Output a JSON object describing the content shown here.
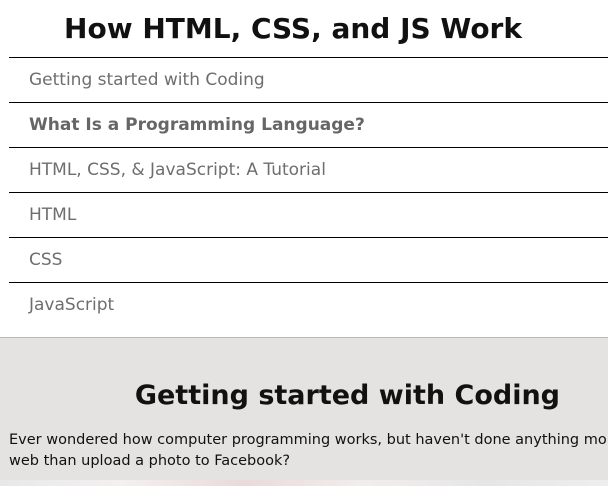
{
  "header": {
    "title": "How HTML, CSS, and JS Work"
  },
  "nav": {
    "items": [
      {
        "label": "Getting started with Coding",
        "bold": false
      },
      {
        "label": "What Is a Programming Language?",
        "bold": true
      },
      {
        "label": "HTML, CSS, & JavaScript: A Tutorial",
        "bold": false
      },
      {
        "label": "HTML",
        "bold": false
      },
      {
        "label": "CSS",
        "bold": false
      },
      {
        "label": "JavaScript",
        "bold": false
      }
    ]
  },
  "main": {
    "section_title": "Getting started with Coding",
    "intro": "Ever wondered how computer programming works, but haven't done anything more web than upload a photo to Facebook?"
  },
  "colors": {
    "nav_text": "#6e6e6e",
    "divider": "#000000",
    "content_background": "#e5e3e1",
    "heading_text": "#111111"
  }
}
